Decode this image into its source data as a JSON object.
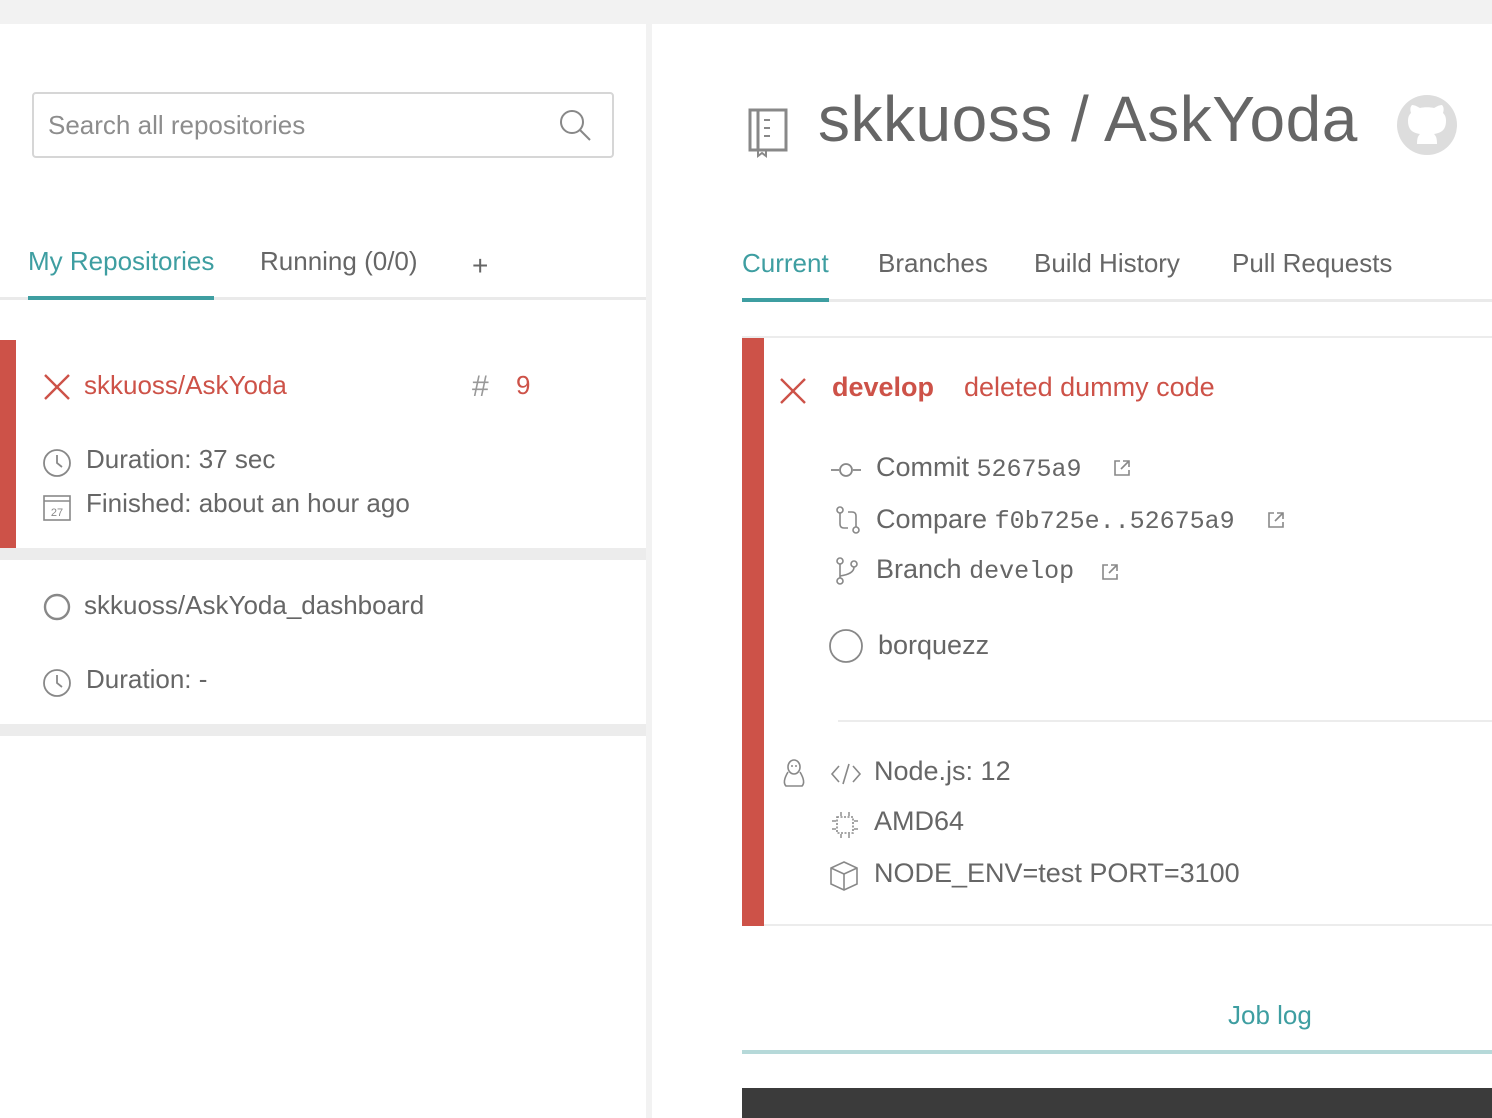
{
  "search": {
    "placeholder": "Search all repositories"
  },
  "left_tabs": {
    "my_repositories": "My Repositories",
    "running": "Running (0/0)",
    "add": "+"
  },
  "repos": [
    {
      "name": "skkuoss/AskYoda",
      "status": "failed",
      "build_hash": "#",
      "build_number": "9",
      "duration": "Duration: 37 sec",
      "finished": "Finished: about an hour ago"
    },
    {
      "name": "skkuoss/AskYoda_dashboard",
      "status": "none",
      "duration": "Duration: -"
    }
  ],
  "header": {
    "title": "skkuoss / AskYoda"
  },
  "tabs": [
    "Current",
    "Branches",
    "Build History",
    "Pull Requests"
  ],
  "build": {
    "branch": "develop",
    "message": "deleted dummy code",
    "commit_label": "Commit",
    "commit_hash": "52675a9",
    "compare_label": "Compare",
    "compare_range": "f0b725e..52675a9",
    "branch_label": "Branch",
    "branch_name": "develop",
    "author": "borquezz",
    "language": "Node.js: 12",
    "arch": "AMD64",
    "env": "NODE_ENV=test PORT=3100"
  },
  "job_log": {
    "label": "Job log"
  },
  "colors": {
    "failed": "#cd5248",
    "accent": "#3e9ea1",
    "text": "#666666"
  }
}
